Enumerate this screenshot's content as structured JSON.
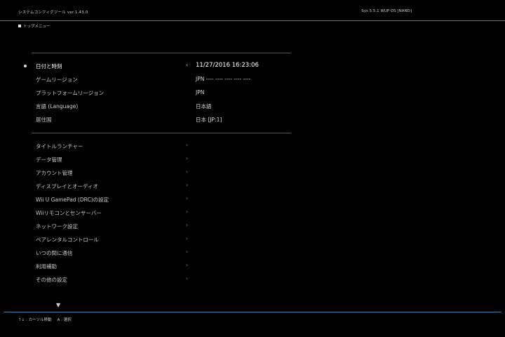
{
  "header": {
    "app_title": "システムコンフィグツール  ver.1.43.0",
    "system_version": "Sys 5.5.1  WUP  OS [NAND]"
  },
  "breadcrumb": "トップメニュー",
  "info_rows": [
    {
      "label": "日付と時刻",
      "value": "11/27/2016 16:23:06"
    },
    {
      "label": "ゲームリージョン",
      "value": "JPN ---- ---- ---- ---- ----"
    },
    {
      "label": "プラットフォームリージョン",
      "value": "JPN"
    },
    {
      "label": "言語 (Language)",
      "value": "日本語"
    },
    {
      "label": "居住国",
      "value": "日本 [JP:1]"
    }
  ],
  "menu_items": [
    {
      "label": "タイトルランチャー"
    },
    {
      "label": "データ管理"
    },
    {
      "label": "アカウント管理"
    },
    {
      "label": "ディスプレイとオーディオ"
    },
    {
      "label": "Wii U GamePad (DRC)の設定"
    },
    {
      "label": "Wiiリモコンとセンサーバー"
    },
    {
      "label": "ネットワーク設定"
    },
    {
      "label": "ペアレンタルコントロール"
    },
    {
      "label": "いつの間に通信"
    },
    {
      "label": "利用補助"
    },
    {
      "label": "その他の設定"
    }
  ],
  "chevron": "›",
  "scroll_indicator": "▼",
  "footer_hints": {
    "scroll": "↑↓ : カーソル移動",
    "select": "A : 選択"
  }
}
